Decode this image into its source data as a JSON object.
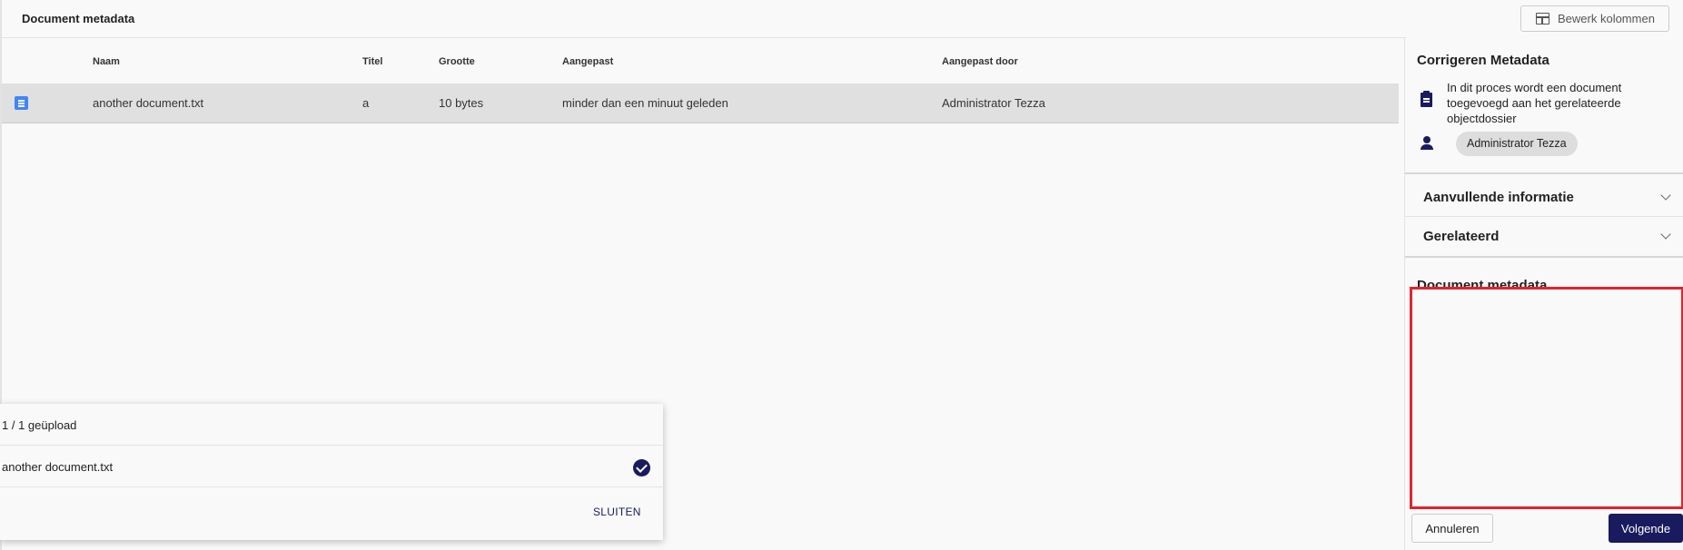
{
  "header": {
    "title": "Document metadata",
    "edit_columns_label": "Bewerk kolommen"
  },
  "table": {
    "columns": [
      "Naam",
      "Titel",
      "Grootte",
      "Aangepast",
      "Aangepast door"
    ],
    "rows": [
      {
        "icon": "document-icon",
        "name": "another document.txt",
        "title": "a",
        "size": "10 bytes",
        "modified": "minder dan een minuut geleden",
        "modified_by": "Administrator Tezza"
      }
    ]
  },
  "upload": {
    "count": "1 / 1 geüpload",
    "file": "another document.txt",
    "status_icon": "check-circle-icon",
    "close_label": "SLUITEN"
  },
  "side_panel": {
    "title": "Corrigeren Metadata",
    "description": "In dit proces wordt een document toegevoegd aan het gerelateerde objectdossier",
    "assignee": "Administrator Tezza",
    "accordions": [
      "Aanvullende informatie",
      "Gerelateerd"
    ],
    "section_title": "Document metadata",
    "cancel_label": "Annuleren",
    "next_label": "Volgende"
  },
  "colors": {
    "accent": "#1a1a5e",
    "highlight": "#e0242e",
    "row_selected": "#e0e0e0"
  }
}
